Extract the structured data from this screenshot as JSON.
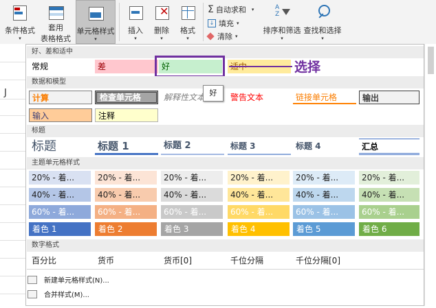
{
  "ribbon": {
    "cond_format": "条件格式",
    "table_format_1": "套用",
    "table_format_2": "表格格式",
    "cell_styles": "单元格样式",
    "insert": "插入",
    "delete": "删除",
    "format": "格式",
    "autosum": "自动求和",
    "fill": "填充",
    "clear": "清除",
    "sort_filter": "排序和筛选",
    "find_select": "查找和选择"
  },
  "sheet": {
    "col_label": "J"
  },
  "sections": {
    "good_bad": "好、差和适中",
    "data_model": "数据和模型",
    "titles": "标题",
    "theme": "主题单元格样式",
    "number": "数字格式"
  },
  "good_bad": {
    "normal": "常规",
    "bad": "差",
    "good": "好",
    "neutral": "适中"
  },
  "annotation": {
    "label": "选择"
  },
  "tooltip": {
    "text": "好"
  },
  "data_model": {
    "calc": "计算",
    "check": "检查单元格",
    "explain": "解释性文本",
    "warn": "警告文本",
    "link": "链接单元格",
    "output": "输出",
    "input": "输入",
    "note": "注释"
  },
  "titles": {
    "title": "标题",
    "h1": "标题 1",
    "h2": "标题 2",
    "h3": "标题 3",
    "h4": "标题 4",
    "total": "汇总"
  },
  "theme": {
    "row20": [
      "20% - 着...",
      "20% - 着...",
      "20% - 着...",
      "20% - 着...",
      "20% - 着...",
      "20% - 着..."
    ],
    "row40": [
      "40% - 着...",
      "40% - 着...",
      "40% - 着...",
      "40% - 着...",
      "40% - 着...",
      "40% - 着..."
    ],
    "row60": [
      "60% - 着...",
      "60% - 着...",
      "60% - 着...",
      "60% - 着...",
      "60% - 着...",
      "60% - 着..."
    ],
    "accent": [
      "着色 1",
      "着色 2",
      "着色 3",
      "着色 4",
      "着色 5",
      "着色 6"
    ]
  },
  "number": {
    "percent": "百分比",
    "currency": "货币",
    "currency0": "货币[0]",
    "comma": "千位分隔",
    "comma0": "千位分隔[0]"
  },
  "menu": {
    "new_style": "新建单元格样式(N)...",
    "merge_style": "合并样式(M)..."
  },
  "colors": {
    "accent1": "#4472c4",
    "accent2": "#ed7d31",
    "accent3": "#a5a5a5",
    "accent4": "#ffc000",
    "accent5": "#5b9bd5",
    "accent6": "#70ad47",
    "highlight": "#7030a0"
  }
}
